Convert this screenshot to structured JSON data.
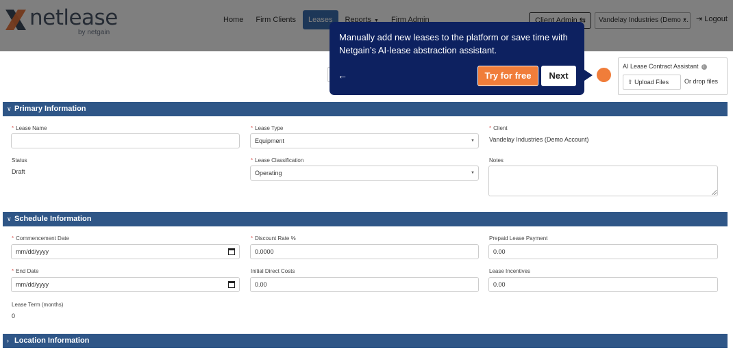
{
  "brand": {
    "name": "netlease",
    "tagline": "by netgain",
    "colors": {
      "blue": "#3d4a5c",
      "orange": "#e8743b",
      "accent": "#2f5687"
    }
  },
  "nav": {
    "items": [
      {
        "label": "Home",
        "active": false
      },
      {
        "label": "Firm Clients",
        "active": false
      },
      {
        "label": "Leases",
        "active": true
      },
      {
        "label": "Reports",
        "active": false,
        "dropdown": true
      },
      {
        "label": "Firm Admin",
        "active": false
      }
    ],
    "client_admin": "Client Admin ⇆",
    "account": "Vandelay Industries (Demo ...",
    "logout": "Logout"
  },
  "ai_assistant": {
    "title": "AI Lease Contract Assistant",
    "upload_label": "Upload Files",
    "drop_label": "Or drop files"
  },
  "tooltip": {
    "text": "Manually add new leases to the platform or save time with Netgain’s AI-lease abstraction assistant.",
    "try_label": "Try for free",
    "next_label": "Next"
  },
  "primary": {
    "header": "Primary Information",
    "lease_name_label": "Lease Name",
    "lease_name_value": "",
    "lease_type_label": "Lease Type",
    "lease_type_value": "Equipment",
    "client_label": "Client",
    "client_value": "Vandelay Industries (Demo Account)",
    "status_label": "Status",
    "status_value": "Draft",
    "classification_label": "Lease Classification",
    "classification_value": "Operating",
    "notes_label": "Notes"
  },
  "schedule": {
    "header": "Schedule Information",
    "commencement_label": "Commencement Date",
    "commencement_value": "mm/dd/yyyy",
    "discount_label": "Discount Rate %",
    "discount_value": "0.0000",
    "prepaid_label": "Prepaid Lease Payment",
    "prepaid_value": "0.00",
    "end_label": "End Date",
    "end_value": "mm/dd/yyyy",
    "idc_label": "Initial Direct Costs",
    "idc_value": "0.00",
    "incentives_label": "Lease Incentives",
    "incentives_value": "0.00",
    "term_label": "Lease Term (months)",
    "term_value": "0"
  },
  "location": {
    "header": "Location Information"
  }
}
